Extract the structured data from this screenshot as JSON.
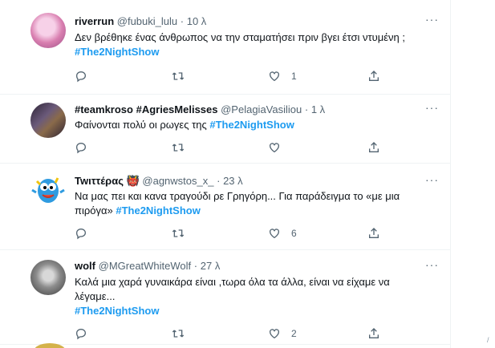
{
  "tweets": [
    {
      "name": "riverrun",
      "handle": "@fubuki_lulu",
      "time": "10 λ",
      "text": "Δεν βρέθηκε ένας άνθρωπος να την σταματήσει πριν βγει έτσι ντυμένη ;",
      "hashtag": "#The2NightShow",
      "likes": "1",
      "avatar_color": "#d97fb0"
    },
    {
      "name": "#teamkroso #AgriesMelisses",
      "handle": "@PelagiaVasiliou",
      "time": "1 λ",
      "text": "Φαίνονται πολύ οι ρωγες της",
      "hashtag": "#The2NightShow",
      "likes": "",
      "avatar_color": "#4a3f5c"
    },
    {
      "name": "Twιττέρας 👹",
      "handle": "@agnwstos_x_",
      "time": "23 λ",
      "text": "Να μας πει και κανα τραγούδι ρε Γρηγόρη... Για παράδειγμα το «με μια πιρόγα»",
      "hashtag": "#The2NightShow",
      "likes": "6",
      "avatar_color": "#2f9be0"
    },
    {
      "name": "wolf",
      "handle": "@MGreatWhiteWolf",
      "time": "27 λ",
      "text": "Καλά μια χαρά γυναικάρα είναι ,τωρα όλα τα άλλα, είναι να είχαμε να λέγαμε...",
      "hashtag": "#The2NightShow",
      "likes": "2",
      "avatar_color": "#7a7a7a"
    }
  ],
  "ui": {
    "dot": "·",
    "more": "···",
    "edge_char": "/"
  },
  "icons": {
    "reply": "reply-icon",
    "retweet": "retweet-icon",
    "like": "like-icon",
    "share": "share-icon"
  }
}
